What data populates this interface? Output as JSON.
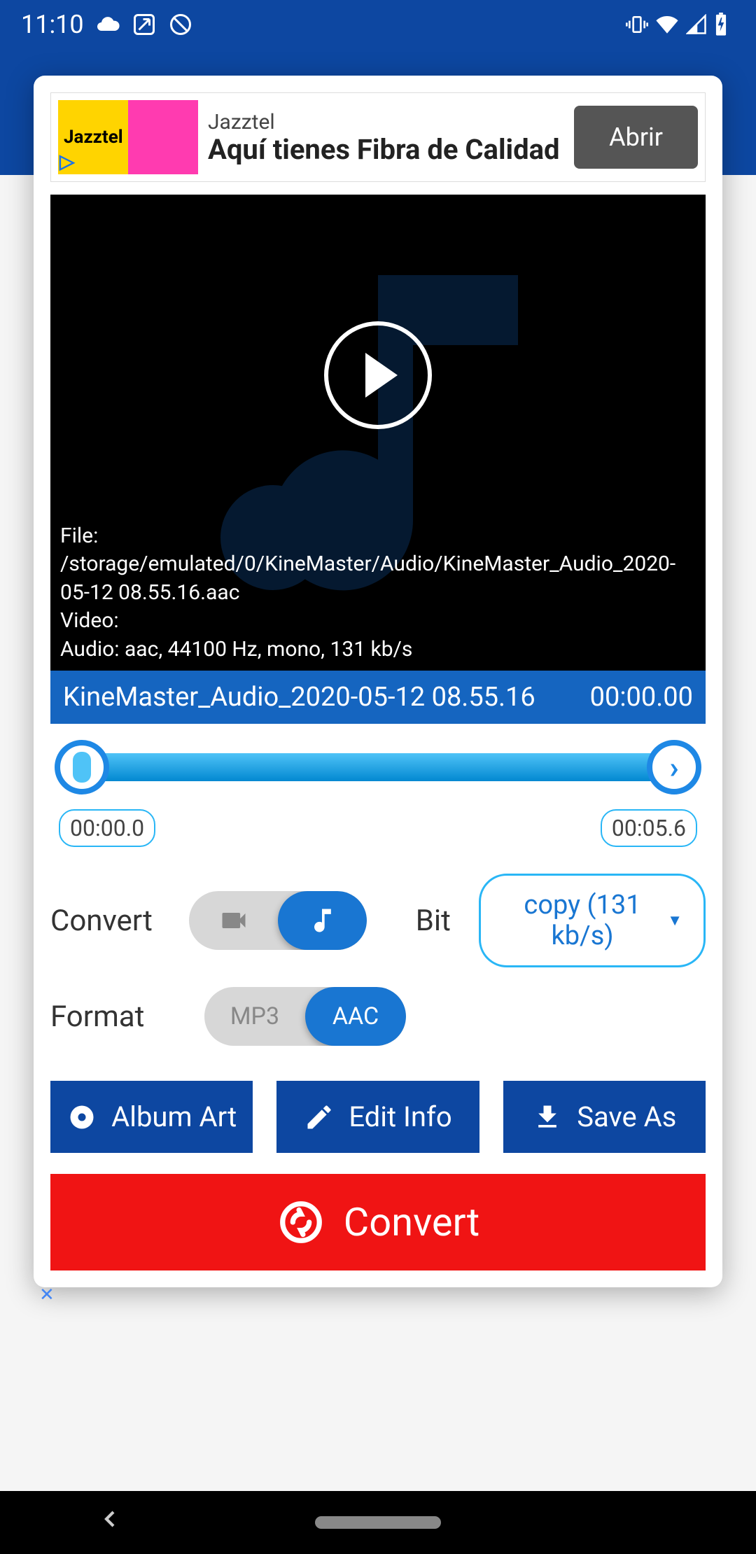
{
  "status": {
    "time": "11:10",
    "icons_left": [
      "cloud-icon",
      "update-icon",
      "do-not-disturb-icon"
    ],
    "icons_right": [
      "vibrate-icon",
      "wifi-icon",
      "signal-icon",
      "battery-charging-icon"
    ]
  },
  "ad": {
    "brand": "Jazztel",
    "headline": "Aquí tienes Fibra de Calidad",
    "cta": "Abrir",
    "img_text": "Jazztel"
  },
  "player": {
    "file_line": "File: /storage/emulated/0/KineMaster/Audio/KineMaster_Audio_2020-05-12 08.55.16.aac",
    "video_line": "Video:",
    "audio_line": "Audio: aac,  44100 Hz,  mono, 131 kb/s"
  },
  "title": {
    "name": "KineMaster_Audio_2020-05-12 08.55.16",
    "elapsed": "00:00.00"
  },
  "trim": {
    "start": "00:00.0",
    "end": "00:05.6"
  },
  "convert": {
    "label": "Convert",
    "options": [
      "video",
      "audio"
    ],
    "active": "audio"
  },
  "bit": {
    "label": "Bit",
    "button": "copy (131 kb/s)"
  },
  "format": {
    "label": "Format",
    "options": [
      "MP3",
      "AAC"
    ],
    "active": "AAC"
  },
  "actions": {
    "album_art": "Album Art",
    "edit_info": "Edit Info",
    "save_as": "Save As"
  },
  "main_action": "Convert"
}
